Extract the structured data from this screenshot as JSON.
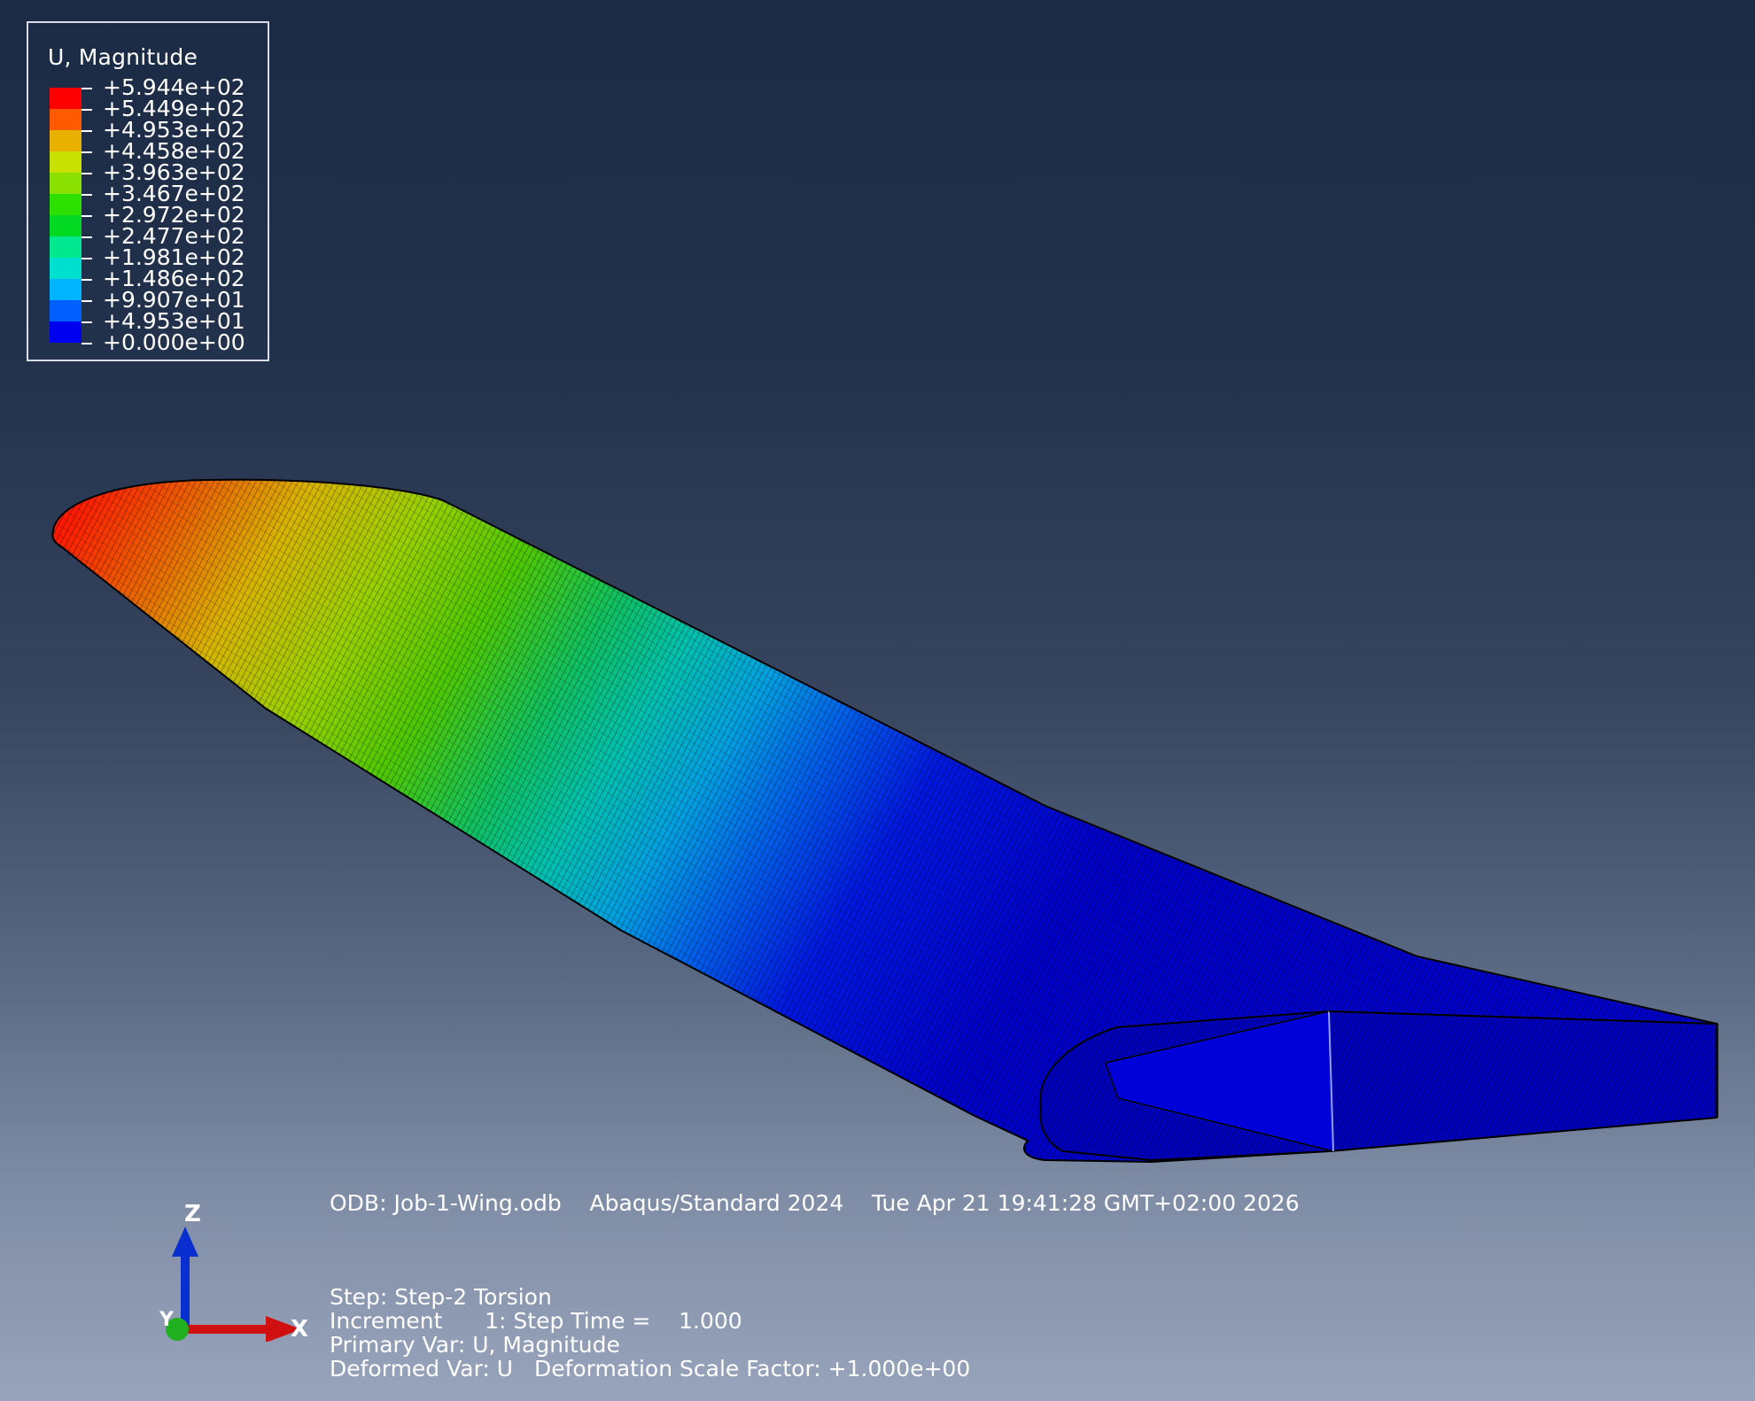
{
  "legend": {
    "title": "U, Magnitude",
    "ticks": [
      "+5.944e+02",
      "+5.449e+02",
      "+4.953e+02",
      "+4.458e+02",
      "+3.963e+02",
      "+3.467e+02",
      "+2.972e+02",
      "+2.477e+02",
      "+1.981e+02",
      "+1.486e+02",
      "+9.907e+01",
      "+4.953e+01",
      "+0.000e+00"
    ],
    "colors": [
      "#ff0000",
      "#ff5a00",
      "#e8b000",
      "#c8e000",
      "#8ae000",
      "#2ee000",
      "#00d822",
      "#00e890",
      "#00e0d0",
      "#00b4ff",
      "#0060ff",
      "#0000f0"
    ]
  },
  "info": {
    "header": "ODB: Job-1-Wing.odb    Abaqus/Standard 2024    Tue Apr 21 19:41:28 GMT+02:00 2026",
    "step": "Step: Step-2 Torsion",
    "increment": "Increment      1: Step Time =    1.000",
    "primary_var": "Primary Var: U, Magnitude",
    "deformed_var": "Deformed Var: U   Deformation Scale Factor: +1.000e+00"
  },
  "triad": {
    "z_label": "Z",
    "x_label": "X",
    "y_label": "Y",
    "colors": {
      "z": "#0a2fd0",
      "x": "#d01010",
      "y": "#20b020"
    }
  }
}
